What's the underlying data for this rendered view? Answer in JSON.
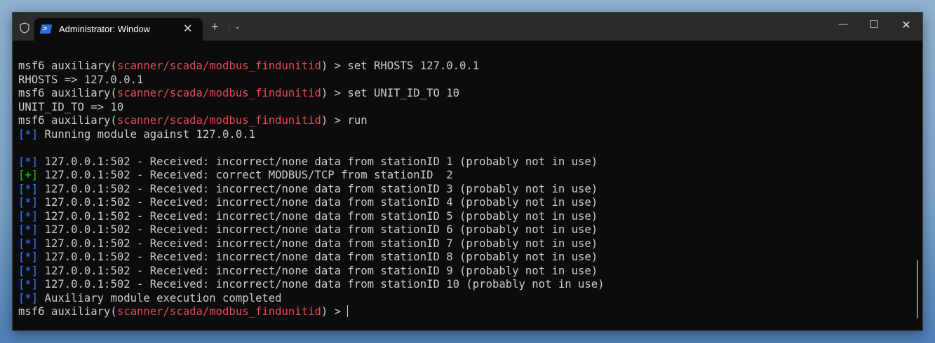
{
  "tab": {
    "title": "Administrator: Windows PowerShell",
    "close": "✕",
    "icon": "powershell-icon"
  },
  "titlebar": {
    "new_tab": "+",
    "dropdown": "⌄",
    "minimize": "—",
    "maximize": "☐",
    "close": "✕"
  },
  "colors": {
    "text": "#cccccc",
    "red": "#e74856",
    "blue": "#3b78ff",
    "green": "#16c60c"
  },
  "terminal": {
    "lines": [
      [
        {
          "t": "msf6 auxiliary("
        },
        {
          "t": "scanner/scada/modbus_findunitid",
          "c": "red"
        },
        {
          "t": ") > set RHOSTS 127.0.0.1"
        }
      ],
      [
        {
          "t": "RHOSTS => 127.0.0.1"
        }
      ],
      [
        {
          "t": "msf6 auxiliary("
        },
        {
          "t": "scanner/scada/modbus_findunitid",
          "c": "red"
        },
        {
          "t": ") > set UNIT_ID_TO 10"
        }
      ],
      [
        {
          "t": "UNIT_ID_TO => 10"
        }
      ],
      [
        {
          "t": "msf6 auxiliary("
        },
        {
          "t": "scanner/scada/modbus_findunitid",
          "c": "red"
        },
        {
          "t": ") > run"
        }
      ],
      [
        {
          "t": "[*]",
          "c": "blue"
        },
        {
          "t": " Running module against 127.0.0.1"
        }
      ],
      [
        {
          "t": ""
        }
      ],
      [
        {
          "t": "[*]",
          "c": "blue"
        },
        {
          "t": " 127.0.0.1:502 - Received: incorrect/none data from stationID 1 (probably not in use)"
        }
      ],
      [
        {
          "t": "[+]",
          "c": "green"
        },
        {
          "t": " 127.0.0.1:502 - Received: correct MODBUS/TCP from stationID  2"
        }
      ],
      [
        {
          "t": "[*]",
          "c": "blue"
        },
        {
          "t": " 127.0.0.1:502 - Received: incorrect/none data from stationID 3 (probably not in use)"
        }
      ],
      [
        {
          "t": "[*]",
          "c": "blue"
        },
        {
          "t": " 127.0.0.1:502 - Received: incorrect/none data from stationID 4 (probably not in use)"
        }
      ],
      [
        {
          "t": "[*]",
          "c": "blue"
        },
        {
          "t": " 127.0.0.1:502 - Received: incorrect/none data from stationID 5 (probably not in use)"
        }
      ],
      [
        {
          "t": "[*]",
          "c": "blue"
        },
        {
          "t": " 127.0.0.1:502 - Received: incorrect/none data from stationID 6 (probably not in use)"
        }
      ],
      [
        {
          "t": "[*]",
          "c": "blue"
        },
        {
          "t": " 127.0.0.1:502 - Received: incorrect/none data from stationID 7 (probably not in use)"
        }
      ],
      [
        {
          "t": "[*]",
          "c": "blue"
        },
        {
          "t": " 127.0.0.1:502 - Received: incorrect/none data from stationID 8 (probably not in use)"
        }
      ],
      [
        {
          "t": "[*]",
          "c": "blue"
        },
        {
          "t": " 127.0.0.1:502 - Received: incorrect/none data from stationID 9 (probably not in use)"
        }
      ],
      [
        {
          "t": "[*]",
          "c": "blue"
        },
        {
          "t": " 127.0.0.1:502 - Received: incorrect/none data from stationID 10 (probably not in use)"
        }
      ],
      [
        {
          "t": "[*]",
          "c": "blue"
        },
        {
          "t": " Auxiliary module execution completed"
        }
      ],
      [
        {
          "t": "msf6 auxiliary("
        },
        {
          "t": "scanner/scada/modbus_findunitid",
          "c": "red"
        },
        {
          "t": ") > "
        }
      ]
    ]
  }
}
